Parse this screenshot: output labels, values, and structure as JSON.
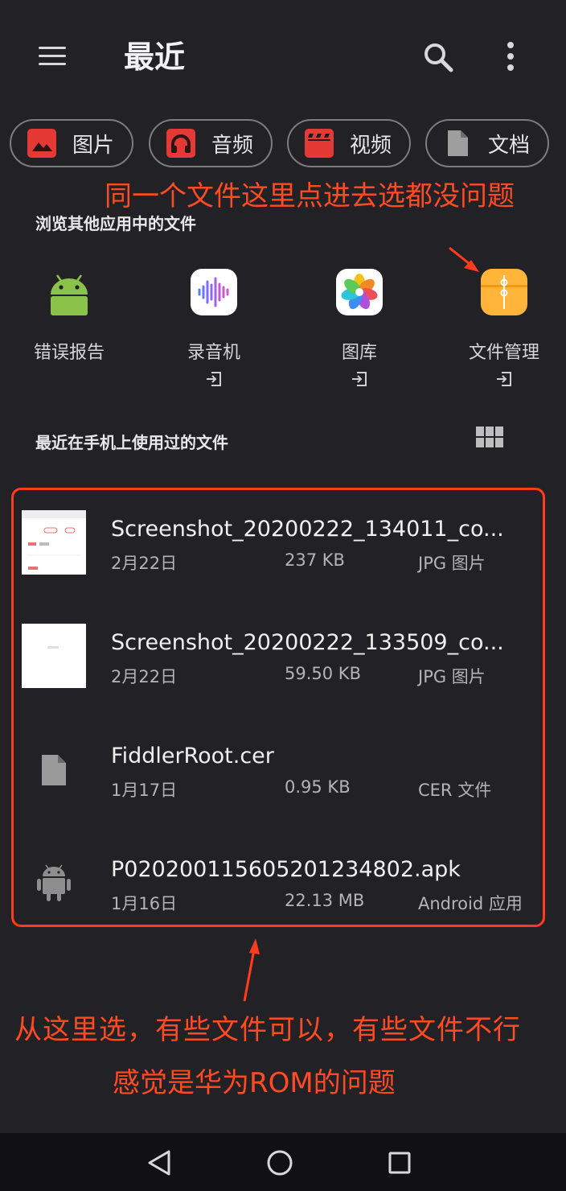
{
  "header": {
    "title": "最近",
    "menu_icon": "hamburger-menu-icon",
    "search_icon": "search-icon",
    "more_icon": "more-vert-icon"
  },
  "chips": [
    {
      "label": "图片",
      "icon": "image-icon",
      "color": "#E53935"
    },
    {
      "label": "音频",
      "icon": "headphones-icon",
      "color": "#E53935"
    },
    {
      "label": "视频",
      "icon": "movie-icon",
      "color": "#E53935"
    },
    {
      "label": "文档",
      "icon": "document-icon",
      "color": "#9E9E9E"
    }
  ],
  "annotations": {
    "note_top": "同一个文件这里点进去选都没问题",
    "note_bottom_1": "从这里选，有些文件可以，有些文件不行",
    "note_bottom_2": "感觉是华为ROM的问题",
    "color": "#FF3B1E"
  },
  "browse_section": {
    "heading": "浏览其他应用中的文件",
    "apps": [
      {
        "label": "错误报告",
        "icon": "android-icon",
        "external": false
      },
      {
        "label": "录音机",
        "icon": "recorder-icon",
        "external": true
      },
      {
        "label": "图库",
        "icon": "gallery-icon",
        "external": true
      },
      {
        "label": "文件管理",
        "icon": "file-manager-icon",
        "external": true
      }
    ]
  },
  "recent_section": {
    "heading": "最近在手机上使用过的文件",
    "view_toggle_icon": "grid-view-icon",
    "files": [
      {
        "name": "Screenshot_20200222_134011_co...",
        "date": "2月22日",
        "size": "237 KB",
        "type": "JPG 图片",
        "thumb": "image-thumbnail"
      },
      {
        "name": "Screenshot_20200222_133509_co...",
        "date": "2月22日",
        "size": "59.50 KB",
        "type": "JPG 图片",
        "thumb": "image-thumbnail"
      },
      {
        "name": "FiddlerRoot.cer",
        "date": "1月17日",
        "size": "0.95 KB",
        "type": "CER 文件",
        "thumb": "file-icon"
      },
      {
        "name": "P020200115605201234802.apk",
        "date": "1月16日",
        "size": "22.13 MB",
        "type": "Android 应用",
        "thumb": "android-icon"
      }
    ]
  },
  "navbar": {
    "back_icon": "back-triangle-icon",
    "home_icon": "home-circle-icon",
    "recents_icon": "recents-square-icon"
  }
}
